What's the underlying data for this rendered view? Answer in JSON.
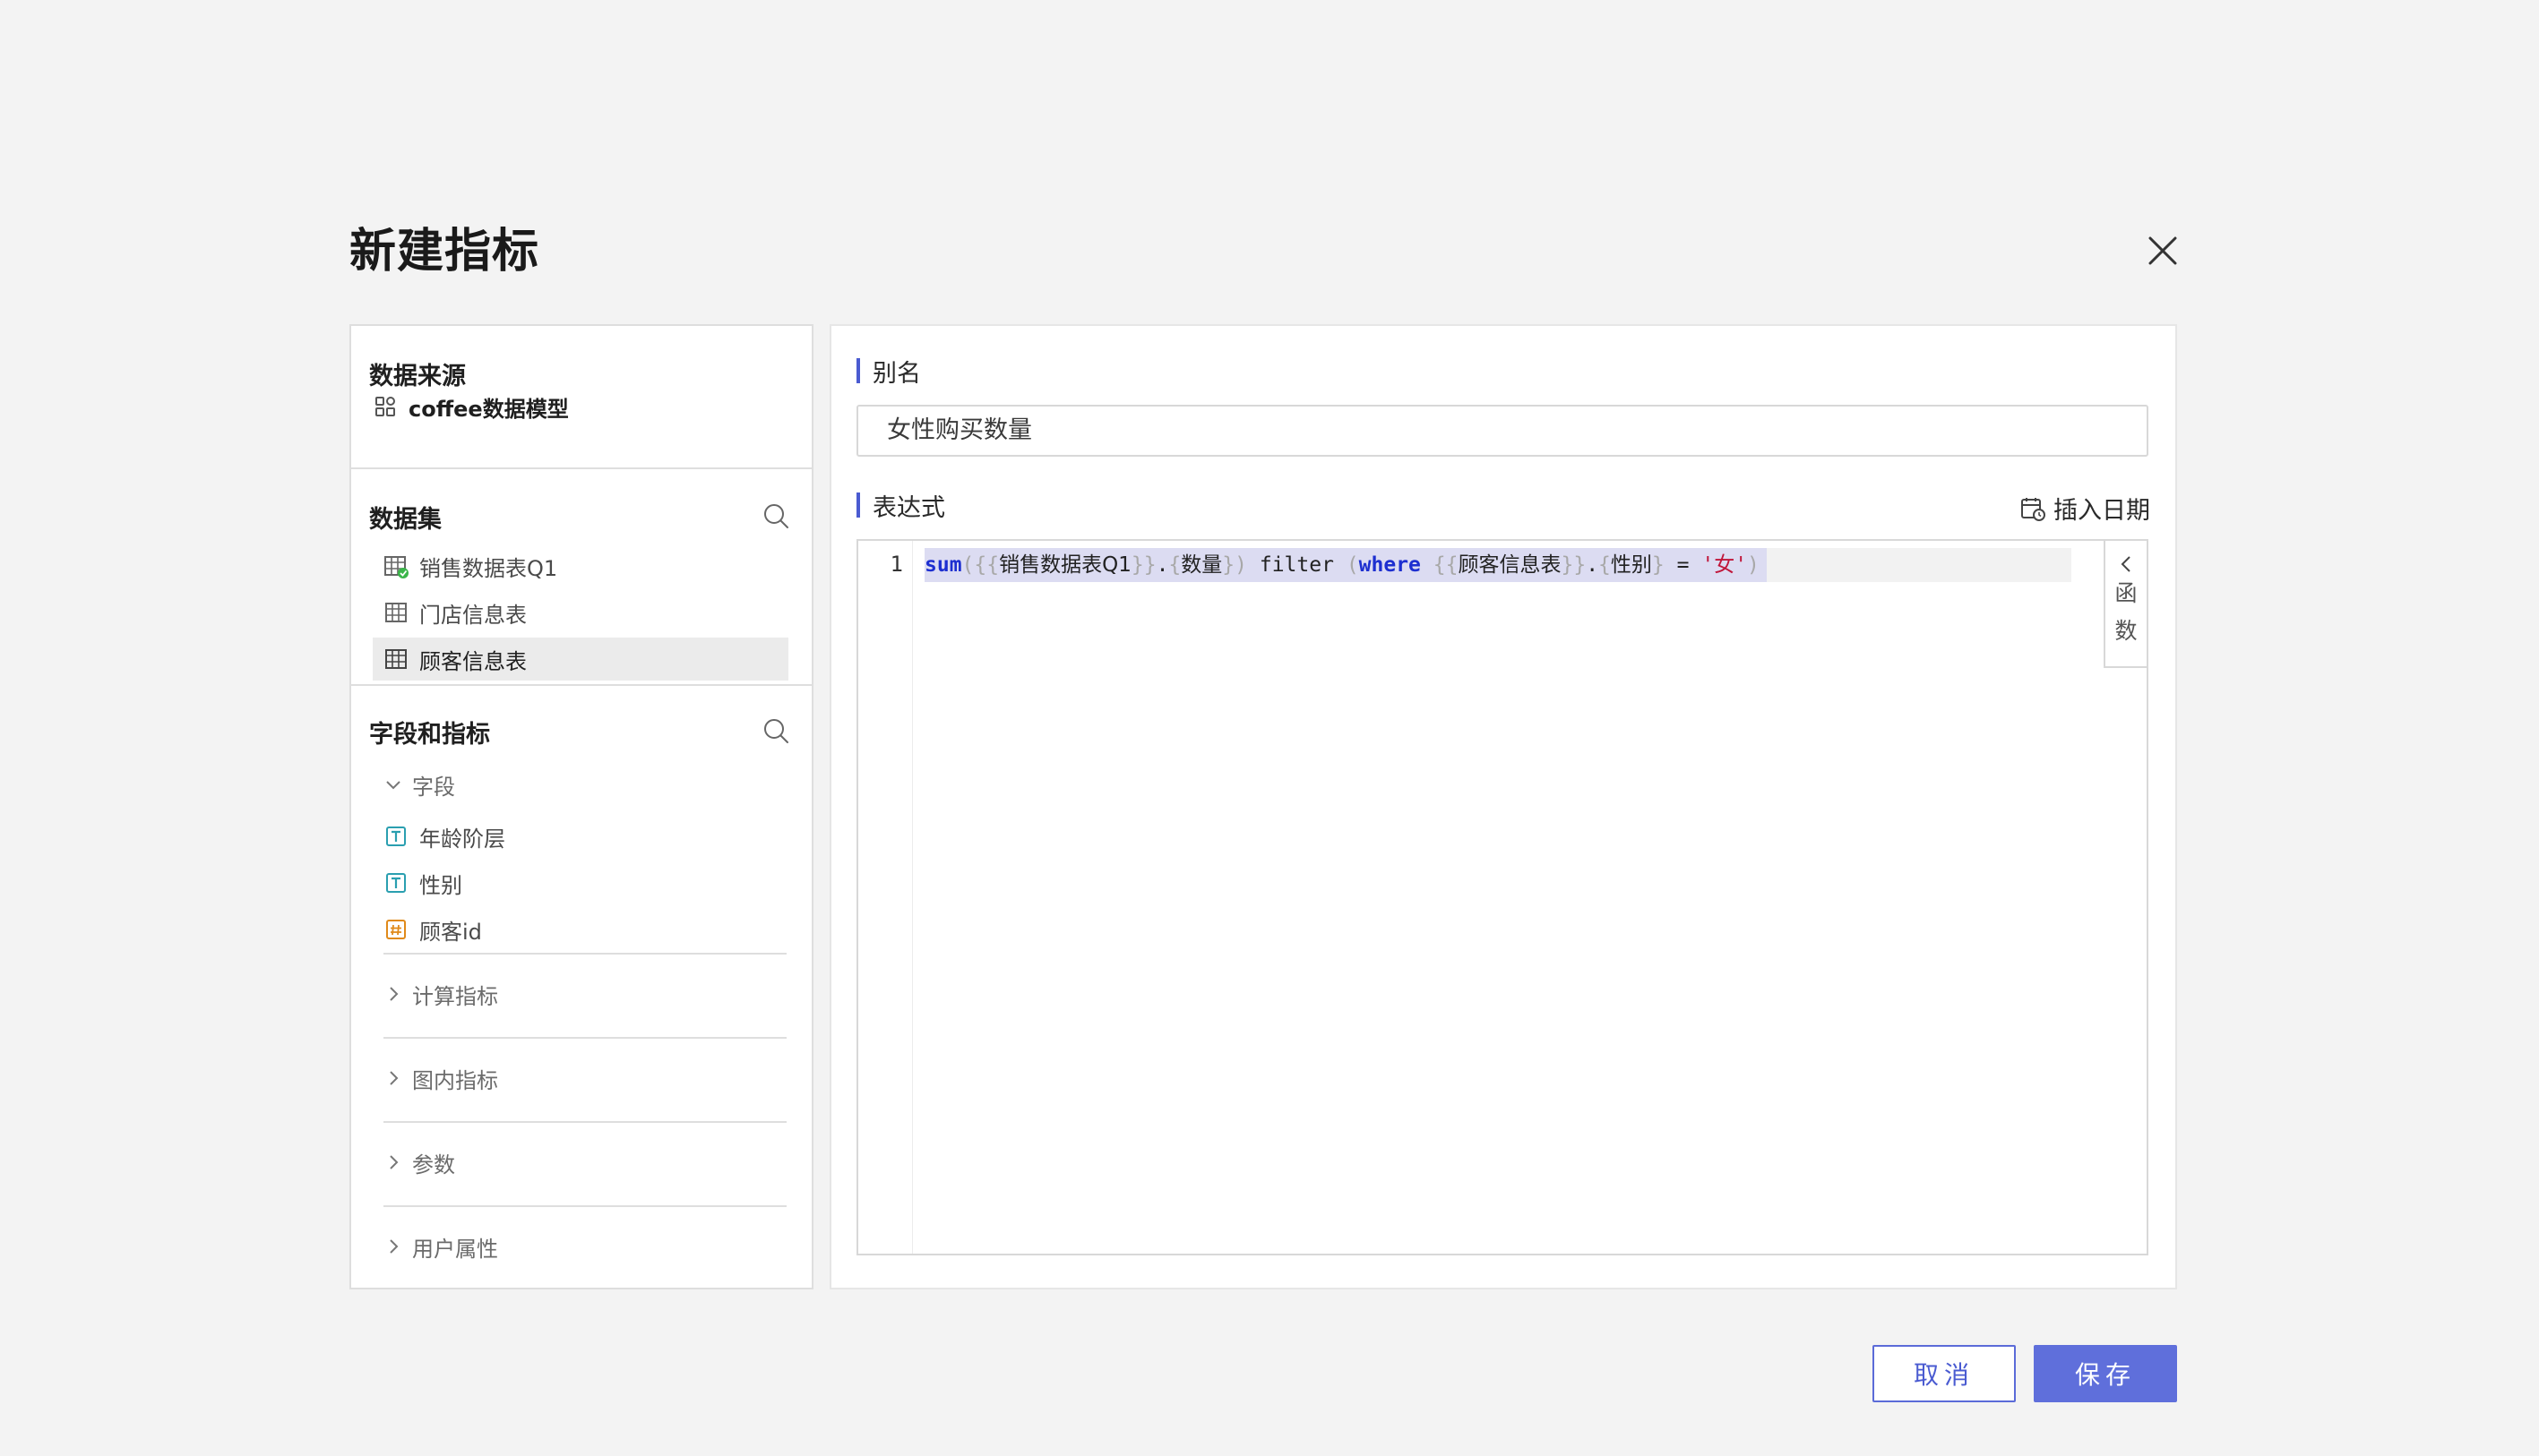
{
  "dialog": {
    "title": "新建指标"
  },
  "left": {
    "data_source": {
      "title": "数据来源",
      "model_name": "coffee数据模型"
    },
    "dataset": {
      "title": "数据集",
      "tables": [
        {
          "label": "销售数据表Q1",
          "status": "connected"
        },
        {
          "label": "门店信息表"
        },
        {
          "label": "顾客信息表",
          "selected": true
        }
      ]
    },
    "fields_metrics": {
      "title": "字段和指标",
      "fields_group": "字段",
      "fields": [
        {
          "label": "年龄阶层",
          "type": "text"
        },
        {
          "label": "性别",
          "type": "text"
        },
        {
          "label": "顾客id",
          "type": "number"
        }
      ],
      "groups": [
        "计算指标",
        "图内指标",
        "参数",
        "用户属性"
      ]
    }
  },
  "right": {
    "alias_label": "别名",
    "alias_value": "女性购买数量",
    "expression_label": "表达式",
    "insert_date": "插入日期",
    "line_number": "1",
    "code": {
      "func": "sum",
      "open_paren": "(",
      "open_braces_1": "{{",
      "table_1": "销售数据表Q1",
      "close_braces_1": "}}",
      "dot_1": ".",
      "open_brace_1": "{",
      "field_1": "数量",
      "close_brace_1": "}",
      "close_paren": ")",
      "filter": "filter",
      "open_paren_2": "(",
      "where": "where",
      "open_braces_2": "{{",
      "table_2": "顾客信息表",
      "close_braces_2": "}}",
      "dot_2": ".",
      "open_brace_2": "{",
      "field_2": "性别",
      "close_brace_2": "}",
      "eq": "=",
      "value": "'女'",
      "close_paren_2": ")"
    },
    "func_tab": [
      "函",
      "数"
    ]
  },
  "footer": {
    "cancel": "取消",
    "save": "保存"
  },
  "colors": {
    "accent": "#5f6fdb",
    "keyword": "#1d2fd0",
    "string": "#c0163a",
    "brace": "#a8a8a8",
    "text_type": "#2a9fb0",
    "number_type": "#e08a1a",
    "connected": "#3bb54a"
  },
  "icons": {
    "close": "close-icon",
    "search": "search-icon",
    "model": "model-icon",
    "table": "table-icon",
    "calendar": "calendar-icon"
  }
}
